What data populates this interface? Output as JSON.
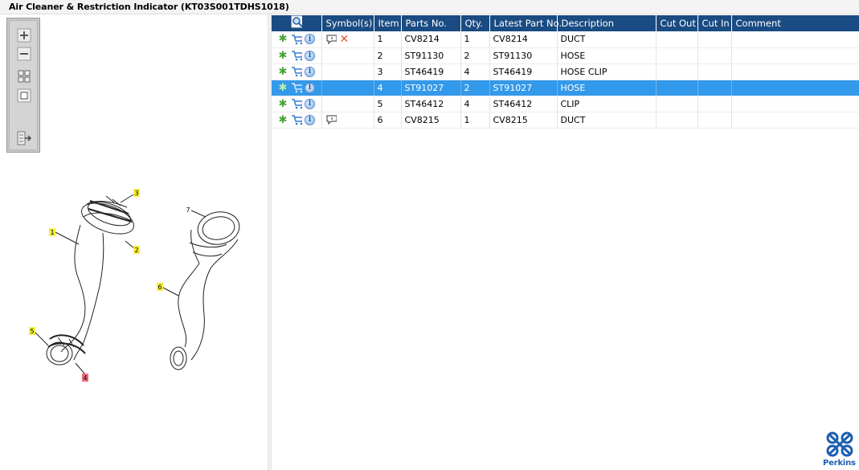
{
  "window": {
    "title": "Air Cleaner & Restriction Indicator (KT03S001TDHS1018)"
  },
  "toolbox": {
    "tools": [
      "zoom-in",
      "zoom-out",
      "fit-all",
      "actual-size",
      "export"
    ]
  },
  "diagram": {
    "callouts": [
      "1",
      "2",
      "3",
      "4",
      "5",
      "6",
      "7"
    ]
  },
  "table": {
    "columns": [
      "Symbol(s)",
      "Item",
      "Parts No.",
      "Qty.",
      "Latest Part No.",
      "Description",
      "Cut Out",
      "Cut In",
      "Comment"
    ],
    "rows": [
      {
        "item": "1",
        "part_no": "CV8214",
        "qty": "1",
        "latest_part_no": "CV8214",
        "description": "DUCT",
        "cut_out": "",
        "cut_in": "",
        "comment": ""
      },
      {
        "item": "2",
        "part_no": "ST91130",
        "qty": "2",
        "latest_part_no": "ST91130",
        "description": "HOSE",
        "cut_out": "",
        "cut_in": "",
        "comment": ""
      },
      {
        "item": "3",
        "part_no": "ST46419",
        "qty": "4",
        "latest_part_no": "ST46419",
        "description": "HOSE CLIP",
        "cut_out": "",
        "cut_in": "",
        "comment": ""
      },
      {
        "item": "4",
        "part_no": "ST91027",
        "qty": "2",
        "latest_part_no": "ST91027",
        "description": "HOSE",
        "cut_out": "",
        "cut_in": "",
        "comment": ""
      },
      {
        "item": "5",
        "part_no": "ST46412",
        "qty": "4",
        "latest_part_no": "ST46412",
        "description": "CLIP",
        "cut_out": "",
        "cut_in": "",
        "comment": ""
      },
      {
        "item": "6",
        "part_no": "CV8215",
        "qty": "1",
        "latest_part_no": "CV8215",
        "description": "DUCT",
        "cut_out": "",
        "cut_in": "",
        "comment": ""
      }
    ],
    "selected_item": "4"
  },
  "logo": {
    "text": "Perkins"
  },
  "colors": {
    "header": "#1a4b82",
    "selected_row": "#3399ea",
    "callout_yellow": "#f7ef3a",
    "callout_highlight": "#ee6f7a",
    "brand": "#1e5fb0"
  },
  "icons": [
    "gear-icon",
    "cart-icon",
    "info-icon",
    "comment-icon",
    "cross-icon",
    "search-icon"
  ]
}
